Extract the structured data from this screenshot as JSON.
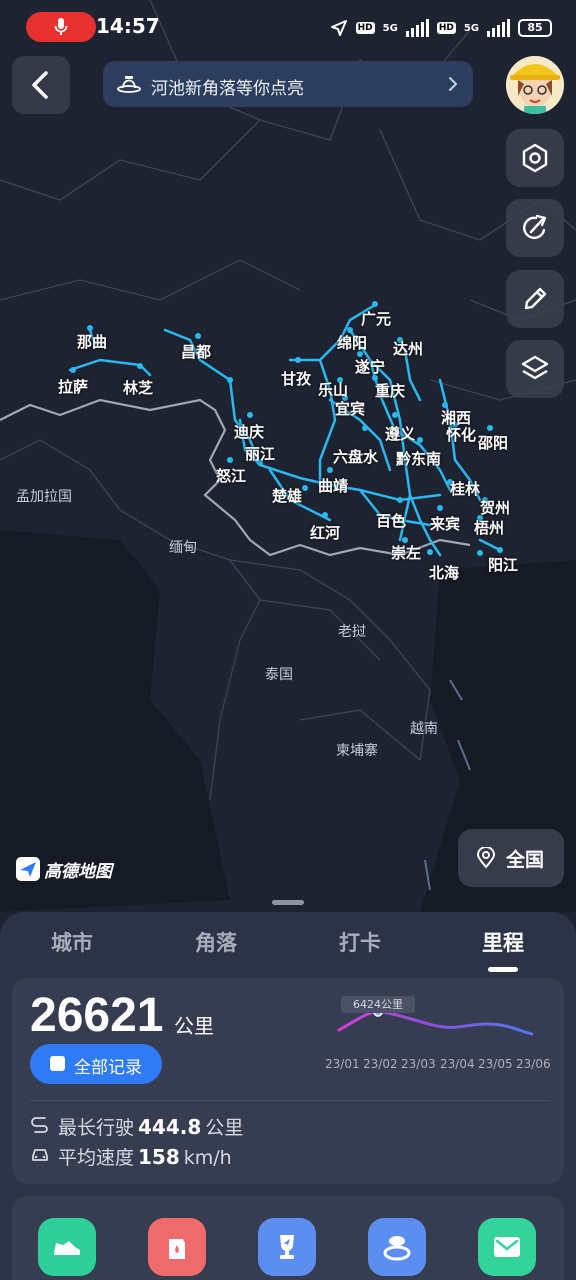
{
  "status_bar": {
    "time": "14:57",
    "hd1": "HD",
    "net1": "5G",
    "hd2": "HD",
    "net2": "5G",
    "battery": "85"
  },
  "banner": {
    "text": "河池新角落等你点亮"
  },
  "map": {
    "brand": "高德地图",
    "cities": [
      {
        "name": "广元"
      },
      {
        "name": "绵阳"
      },
      {
        "name": "达州"
      },
      {
        "name": "昌都"
      },
      {
        "name": "那曲"
      },
      {
        "name": "遂宁"
      },
      {
        "name": "甘孜"
      },
      {
        "name": "乐山"
      },
      {
        "name": "重庆"
      },
      {
        "name": "拉萨"
      },
      {
        "name": "林芝"
      },
      {
        "name": "宜宾"
      },
      {
        "name": "湘西"
      },
      {
        "name": "迪庆"
      },
      {
        "name": "怀化"
      },
      {
        "name": "遵义"
      },
      {
        "name": "邵阳"
      },
      {
        "name": "丽江"
      },
      {
        "name": "六盘水"
      },
      {
        "name": "黔东南"
      },
      {
        "name": "怒江"
      },
      {
        "name": "桂林"
      },
      {
        "name": "楚雄"
      },
      {
        "name": "曲靖"
      },
      {
        "name": "贺州"
      },
      {
        "name": "百色"
      },
      {
        "name": "来宾"
      },
      {
        "name": "红河"
      },
      {
        "name": "梧州"
      },
      {
        "name": "崇左"
      },
      {
        "name": "阳江"
      },
      {
        "name": "北海"
      }
    ],
    "countries": [
      "孟加拉国",
      "缅甸",
      "老挝",
      "泰国",
      "越南",
      "柬埔寨"
    ],
    "nation_button": "全国"
  },
  "tabs": [
    {
      "label": "城市",
      "active": false
    },
    {
      "label": "角落",
      "active": false
    },
    {
      "label": "打卡",
      "active": false
    },
    {
      "label": "里程",
      "active": true
    }
  ],
  "mileage": {
    "total": "26621",
    "unit": "公里",
    "records_button": "全部记录",
    "chart_tooltip": "6424公里",
    "months": [
      "23/01",
      "23/02",
      "23/03",
      "23/04",
      "23/05",
      "23/06"
    ],
    "longest_label": "最长行驶",
    "longest_value": "444.8",
    "longest_unit": "公里",
    "avg_label": "平均速度",
    "avg_value": "158",
    "avg_unit": "km/h"
  },
  "colors": {
    "route": "#2ab8f0",
    "accent_blue": "#2f7bf5",
    "quick_green": "#2fcf9a",
    "quick_red": "#ef6a6a",
    "quick_blue": "#5c8ef0",
    "quick_mint": "#33d39a"
  },
  "quick_actions": [
    {
      "icon": "shoe-icon"
    },
    {
      "icon": "fuel-icon"
    },
    {
      "icon": "trophy-icon"
    },
    {
      "icon": "driver-icon"
    },
    {
      "icon": "mail-icon"
    }
  ]
}
